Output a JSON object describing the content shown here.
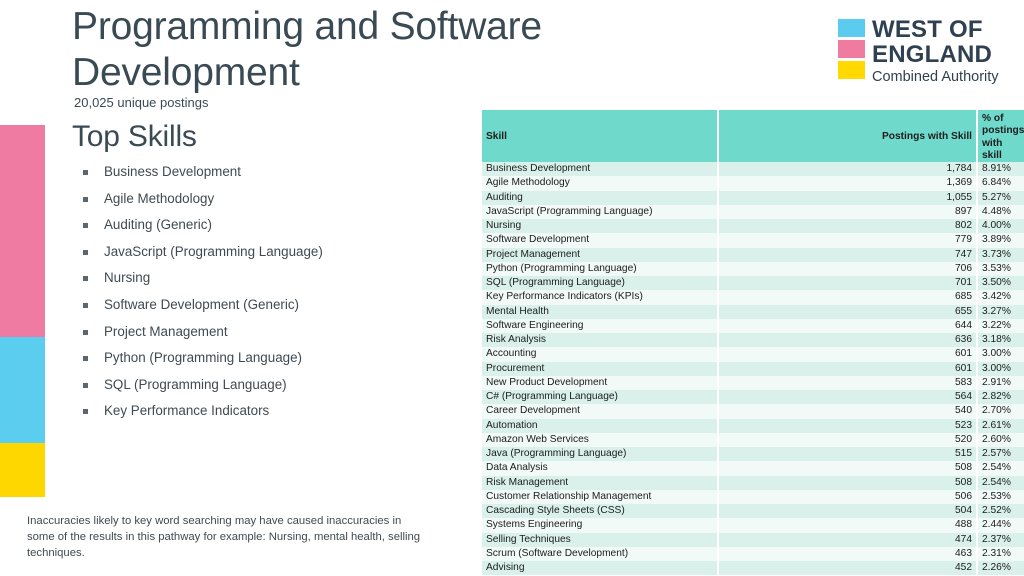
{
  "header": {
    "title": "Programming and Software Development",
    "subtitle": "20,025 unique postings",
    "section_heading": "Top Skills"
  },
  "logo": {
    "line1": "WEST OF",
    "line2": "ENGLAND",
    "line3": "Combined Authority",
    "swatch_colors": [
      "#5BCBEF",
      "#F07BA0",
      "#FFD900"
    ]
  },
  "brand_colors": {
    "pink": "#EF7BA2",
    "blue": "#5BCDEF",
    "yellow": "#FFD700",
    "teal_header": "#6FD9CC",
    "row_dark": "#D9F1EA",
    "row_light": "#F1FAF7",
    "text_dark": "#3a4a54"
  },
  "skills_list": [
    "Business Development",
    "Agile Methodology",
    "Auditing (Generic)",
    "JavaScript (Programming Language)",
    "Nursing",
    "Software Development (Generic)",
    "Project Management",
    "Python (Programming Language)",
    "SQL (Programming Language)",
    "Key Performance Indicators"
  ],
  "footnote": "Inaccuracies likely to key word searching may have caused inaccuracies in some of the results in this pathway for example: Nursing, mental health, selling techniques.",
  "chart_data": {
    "type": "table",
    "title": "Top Skills",
    "columns": [
      "Skill",
      "Postings with Skill",
      "% of postings with skill"
    ],
    "categories": [
      "Business Development",
      "Agile Methodology",
      "Auditing",
      "JavaScript (Programming Language)",
      "Nursing",
      "Software Development",
      "Project Management",
      "Python (Programming Language)",
      "SQL (Programming Language)",
      "Key Performance Indicators (KPIs)",
      "Mental Health",
      "Software Engineering",
      "Risk Analysis",
      "Accounting",
      "Procurement",
      "New Product Development",
      "C# (Programming Language)",
      "Career Development",
      "Automation",
      "Amazon Web Services",
      "Java (Programming Language)",
      "Data Analysis",
      "Risk Management",
      "Customer Relationship Management",
      "Cascading Style Sheets (CSS)",
      "Systems Engineering",
      "Selling Techniques",
      "Scrum (Software Development)",
      "Advising"
    ],
    "series": [
      {
        "name": "Postings with Skill",
        "values": [
          1784,
          1369,
          1055,
          897,
          802,
          779,
          747,
          706,
          701,
          685,
          655,
          644,
          636,
          601,
          601,
          583,
          564,
          540,
          523,
          520,
          515,
          508,
          508,
          506,
          504,
          488,
          474,
          463,
          452
        ]
      },
      {
        "name": "% of postings with skill",
        "values": [
          8.91,
          6.84,
          5.27,
          4.48,
          4.0,
          3.89,
          3.73,
          3.53,
          3.5,
          3.42,
          3.27,
          3.22,
          3.18,
          3.0,
          3.0,
          2.91,
          2.82,
          2.7,
          2.61,
          2.6,
          2.57,
          2.54,
          2.54,
          2.53,
          2.52,
          2.44,
          2.37,
          2.31,
          2.26
        ]
      }
    ],
    "total_postings": 20025
  },
  "table": {
    "header": {
      "skill": "Skill",
      "count": "Postings with Skill",
      "pct": "% of postings with skill"
    },
    "rows": [
      {
        "skill": "Business Development",
        "count": "1,784",
        "pct": "8.91%"
      },
      {
        "skill": "Agile Methodology",
        "count": "1,369",
        "pct": "6.84%"
      },
      {
        "skill": "Auditing",
        "count": "1,055",
        "pct": "5.27%"
      },
      {
        "skill": "JavaScript (Programming Language)",
        "count": "897",
        "pct": "4.48%"
      },
      {
        "skill": "Nursing",
        "count": "802",
        "pct": "4.00%"
      },
      {
        "skill": "Software Development",
        "count": "779",
        "pct": "3.89%"
      },
      {
        "skill": "Project Management",
        "count": "747",
        "pct": "3.73%"
      },
      {
        "skill": "Python (Programming Language)",
        "count": "706",
        "pct": "3.53%"
      },
      {
        "skill": "SQL (Programming Language)",
        "count": "701",
        "pct": "3.50%"
      },
      {
        "skill": "Key Performance Indicators (KPIs)",
        "count": "685",
        "pct": "3.42%"
      },
      {
        "skill": "Mental Health",
        "count": "655",
        "pct": "3.27%"
      },
      {
        "skill": "Software Engineering",
        "count": "644",
        "pct": "3.22%"
      },
      {
        "skill": "Risk Analysis",
        "count": "636",
        "pct": "3.18%"
      },
      {
        "skill": "Accounting",
        "count": "601",
        "pct": "3.00%"
      },
      {
        "skill": "Procurement",
        "count": "601",
        "pct": "3.00%"
      },
      {
        "skill": "New Product Development",
        "count": "583",
        "pct": "2.91%"
      },
      {
        "skill": "C# (Programming Language)",
        "count": "564",
        "pct": "2.82%"
      },
      {
        "skill": "Career Development",
        "count": "540",
        "pct": "2.70%"
      },
      {
        "skill": "Automation",
        "count": "523",
        "pct": "2.61%"
      },
      {
        "skill": "Amazon Web Services",
        "count": "520",
        "pct": "2.60%"
      },
      {
        "skill": "Java (Programming Language)",
        "count": "515",
        "pct": "2.57%"
      },
      {
        "skill": "Data Analysis",
        "count": "508",
        "pct": "2.54%"
      },
      {
        "skill": "Risk Management",
        "count": "508",
        "pct": "2.54%"
      },
      {
        "skill": "Customer Relationship Management",
        "count": "506",
        "pct": "2.53%"
      },
      {
        "skill": "Cascading Style Sheets (CSS)",
        "count": "504",
        "pct": "2.52%"
      },
      {
        "skill": "Systems Engineering",
        "count": "488",
        "pct": "2.44%"
      },
      {
        "skill": "Selling Techniques",
        "count": "474",
        "pct": "2.37%"
      },
      {
        "skill": "Scrum (Software Development)",
        "count": "463",
        "pct": "2.31%"
      },
      {
        "skill": "Advising",
        "count": "452",
        "pct": "2.26%"
      }
    ]
  }
}
